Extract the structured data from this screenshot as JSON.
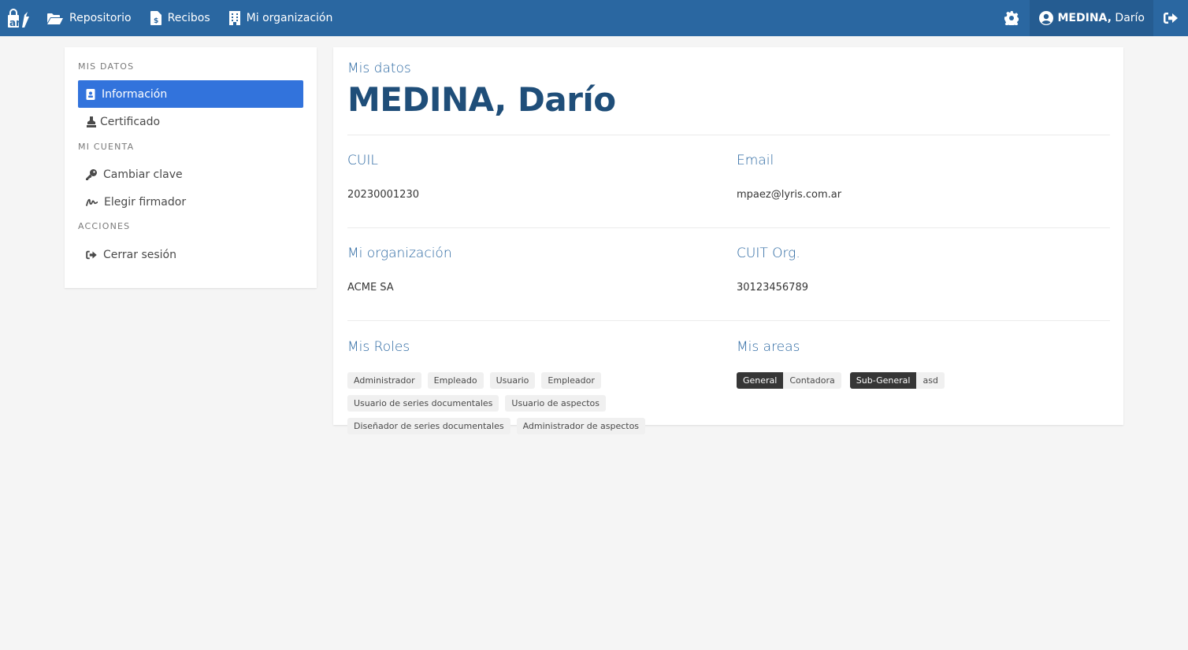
{
  "navbar": {
    "items": [
      {
        "label": "Repositorio",
        "icon": "folder-open-icon"
      },
      {
        "label": "Recibos",
        "icon": "file-invoice-dollar-icon"
      },
      {
        "label": "Mi organización",
        "icon": "building-icon"
      }
    ],
    "user": {
      "last_name": "MEDINA,",
      "first_name": " Darío"
    },
    "brand_color": "#2a67a1"
  },
  "sidebar": {
    "sections": [
      {
        "label": "MIS DATOS",
        "items": [
          {
            "label": "Información",
            "icon": "id-badge-icon",
            "active": true
          },
          {
            "label": "Certificado",
            "icon": "stamp-icon"
          }
        ]
      },
      {
        "label": "MI CUENTA",
        "items": [
          {
            "label": "Cambiar clave",
            "icon": "key-icon"
          },
          {
            "label": "Elegir firmador",
            "icon": "signature-icon"
          }
        ]
      },
      {
        "label": "ACCIONES",
        "items": [
          {
            "label": "Cerrar sesión",
            "icon": "sign-out-icon"
          }
        ]
      }
    ]
  },
  "main": {
    "subtitle": "Mis datos",
    "title": "MEDINA, Darío",
    "cuil": {
      "label": "CUIL",
      "value": "20230001230"
    },
    "email": {
      "label": "Email",
      "value": "mpaez@lyris.com.ar"
    },
    "org": {
      "label": "Mi organización",
      "value": "ACME SA"
    },
    "cuit": {
      "label": "CUIT Org.",
      "value": "30123456789"
    },
    "roles": {
      "label": "Mis Roles",
      "tags": [
        "Administrador",
        "Empleado",
        "Usuario",
        "Empleador",
        "Usuario de series documentales",
        "Usuario de aspectos",
        "Diseñador de series documentales",
        "Administrador de aspectos"
      ]
    },
    "areas": {
      "label": "Mis areas",
      "pairs": [
        {
          "primary": "General",
          "secondary": "Contadora"
        },
        {
          "primary": "Sub-General",
          "secondary": "asd"
        }
      ]
    }
  }
}
